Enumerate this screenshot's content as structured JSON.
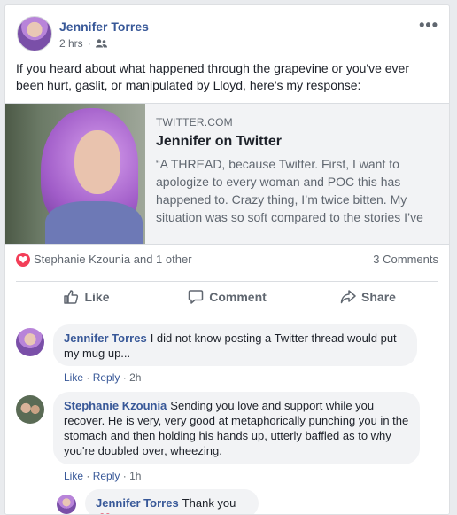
{
  "post": {
    "author": "Jennifer Torres",
    "time": "2 hrs",
    "audience_icon": "friends-icon",
    "more_icon": "more-dots-icon",
    "more_label": "•••",
    "text": "If you heard about what happened through the grapevine or you've ever been hurt, gaslit, or manipulated by Lloyd, here's my response:"
  },
  "link": {
    "domain": "TWITTER.COM",
    "title": "Jennifer on Twitter",
    "description": "“A THREAD, because Twitter. First, I want to apologize to every woman and POC this has happened to. Crazy thing, I’m twice bitten. My situation was so soft compared to the stories I’ve"
  },
  "reactions": {
    "icon": "love-reaction-icon",
    "reactors": "Stephanie Kzounia and 1 other",
    "comments": "3 Comments"
  },
  "actions": {
    "like": "Like",
    "comment": "Comment",
    "share": "Share"
  },
  "comments": [
    {
      "name": "Jennifer Torres",
      "text": "I did not know posting a Twitter thread would put my mug up...",
      "like": "Like",
      "reply": "Reply",
      "sep": "·",
      "time": "2h"
    },
    {
      "name": "Stephanie Kzounia",
      "text": "Sending you love and support while you recover. He is very, very good at metaphorically punching you in the stomach and then holding his hands up, utterly baffled as to why you're doubled over, wheezing.",
      "like": "Like",
      "reply": "Reply",
      "sep": "·",
      "time": "1h"
    }
  ],
  "reply": {
    "name": "Jennifer Torres",
    "text": "Thank you",
    "emoji_icon": "heart-emoji-icon"
  },
  "colors": {
    "link_blue": "#385898",
    "love_red": "#f33e58",
    "heart_emoji": "#e74c66"
  }
}
